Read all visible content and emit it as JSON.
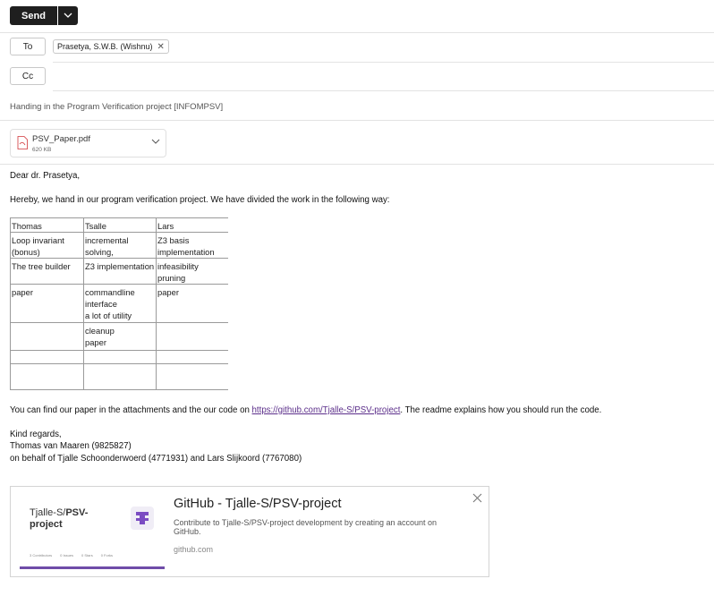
{
  "toolbar": {
    "send_label": "Send"
  },
  "recipients": {
    "to_label": "To",
    "to_chip": "Prasetya, S.W.B. (Wishnu)",
    "cc_label": "Cc"
  },
  "subject": "Handing in the Program Verification project [INFOMPSV]",
  "attachment": {
    "name": "PSV_Paper.pdf",
    "size": "620 KB"
  },
  "body": {
    "greeting": "Dear dr. Prasetya,",
    "intro": "Hereby, we hand in our program verification project. We have divided the work in the following way:",
    "table": {
      "headers": [
        "Thomas",
        "Tsalle",
        "Lars"
      ],
      "rows": [
        [
          "Loop invariant (bonus)",
          " incremental solving,",
          "Z3 basis implementation"
        ],
        [
          "The tree builder",
          "Z3 implementation",
          "infeasibility pruning"
        ],
        [
          "paper",
          "commandline interface",
          "paper"
        ],
        [
          "",
          "a lot of utility",
          ""
        ],
        [
          "",
          "cleanup",
          ""
        ],
        [
          "",
          "paper",
          ""
        ],
        [
          "",
          "",
          ""
        ],
        [
          "",
          "",
          ""
        ]
      ]
    },
    "paper_line_before": "You can find our paper in the attachments and the our code on ",
    "paper_link": "https://github.com/Tjalle-S/PSV-project",
    "paper_line_after": ". The readme explains how you should run the code.",
    "closing": "Kind regards,",
    "signature": "Thomas van Maaren (9825827)",
    "behalf": "on behalf of Tjalle Schoonderwoerd (4771931) and Lars Slijkoord (7767080)"
  },
  "link_card": {
    "thumb_owner": "Tjalle-S/",
    "thumb_repo_part1": "PSV-",
    "thumb_repo_part2": "project",
    "thumb_stats": [
      "3 Contributors",
      "0 Issues",
      "0 Stars",
      "0 Forks"
    ],
    "title": "GitHub - Tjalle-S/PSV-project",
    "description": "Contribute to Tjalle-S/PSV-project development by creating an account on GitHub.",
    "domain": "github.com"
  },
  "colors": {
    "send_bg": "#1f1f1f",
    "link": "#5b2e8a",
    "spell_underline": "#d13438",
    "card_bar": "#6f4ca8"
  },
  "icons": [
    "chevron-down-icon",
    "close-icon",
    "pdf-file-icon",
    "github-logo-icon"
  ]
}
